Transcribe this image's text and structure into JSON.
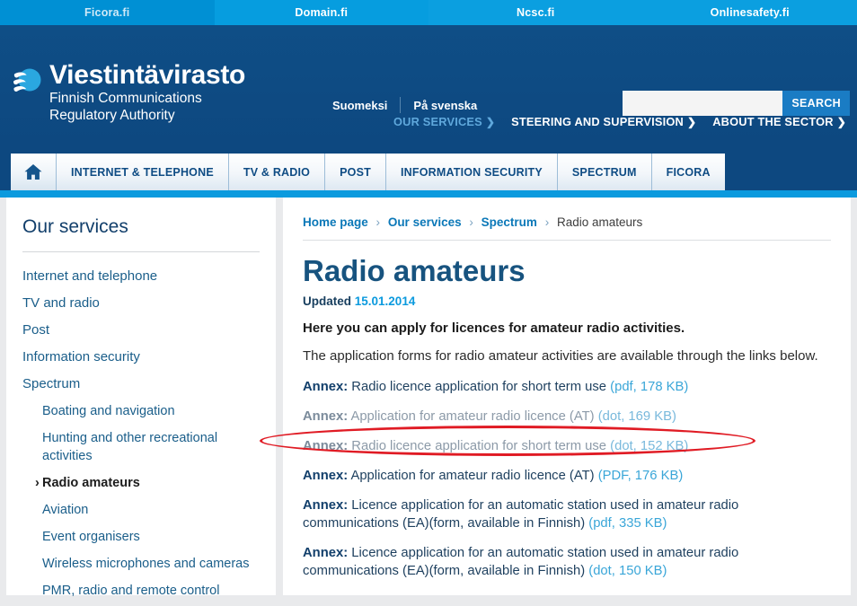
{
  "topbar": {
    "items": [
      {
        "label": "Ficora.fi"
      },
      {
        "label": "Domain.fi"
      },
      {
        "label": "Ncsc.fi"
      },
      {
        "label": "Onlinesafety.fi"
      }
    ]
  },
  "header": {
    "logo_title": "Viestintävirasto",
    "logo_sub_line1": "Finnish Communications",
    "logo_sub_line2": "Regulatory Authority",
    "logo_icon": "globe-icon",
    "lang_fi": "Suomeksi",
    "lang_sv": "På svenska",
    "search_value": "",
    "search_placeholder": "",
    "search_button": "SEARCH",
    "subnav": [
      {
        "label": "OUR SERVICES",
        "active": true
      },
      {
        "label": "STEERING AND SUPERVISION",
        "active": false
      },
      {
        "label": "ABOUT THE SECTOR",
        "active": false
      }
    ]
  },
  "nav": {
    "home_icon": "home-icon",
    "tabs": [
      {
        "label": "INTERNET & TELEPHONE"
      },
      {
        "label": "TV & RADIO"
      },
      {
        "label": "POST"
      },
      {
        "label": "INFORMATION SECURITY"
      },
      {
        "label": "SPECTRUM"
      },
      {
        "label": "FICORA"
      }
    ]
  },
  "sidebar": {
    "title": "Our services",
    "items": [
      {
        "label": "Internet and telephone",
        "level": 1,
        "active": false
      },
      {
        "label": "TV and radio",
        "level": 1,
        "active": false
      },
      {
        "label": "Post",
        "level": 1,
        "active": false
      },
      {
        "label": "Information security",
        "level": 1,
        "active": false
      },
      {
        "label": "Spectrum",
        "level": 1,
        "active": false
      },
      {
        "label": "Boating and navigation",
        "level": 2,
        "active": false
      },
      {
        "label": "Hunting and other recreational activities",
        "level": 2,
        "active": false
      },
      {
        "label": "Radio amateurs",
        "level": 2,
        "active": true,
        "chevron": "›"
      },
      {
        "label": "Aviation",
        "level": 2,
        "active": false
      },
      {
        "label": "Event organisers",
        "level": 2,
        "active": false
      },
      {
        "label": "Wireless microphones and cameras",
        "level": 2,
        "active": false
      },
      {
        "label": "PMR, radio and remote control",
        "level": 2,
        "active": false
      }
    ]
  },
  "content": {
    "breadcrumb": [
      {
        "label": "Home page",
        "link": true
      },
      {
        "label": "Our services",
        "link": true
      },
      {
        "label": "Spectrum",
        "link": true
      },
      {
        "label": "Radio amateurs",
        "link": false
      }
    ],
    "breadcrumb_separator": "›",
    "title": "Radio amateurs",
    "updated_label": "Updated",
    "updated_date": "15.01.2014",
    "lead": "Here you can apply for licences for amateur radio activities.",
    "intro": "The application forms for radio amateur activities are available through the links below.",
    "annex_label": "Annex:",
    "annexes": [
      {
        "text": "Radio licence application for short term use",
        "meta": "(pdf, 178 KB)",
        "dim": false
      },
      {
        "text": "Application for amateur radio licence (AT)",
        "meta": "(dot, 169 KB)",
        "dim": true
      },
      {
        "text": "Radio licence application for short term use",
        "meta": "(dot, 152 KB)",
        "dim": true
      },
      {
        "text": "Application for amateur radio licence (AT)",
        "meta": "(PDF, 176 KB)",
        "dim": false
      },
      {
        "text": "Licence application for an automatic station used in amateur radio communications (EA)(form, available in Finnish)",
        "meta": "(pdf, 335 KB)",
        "dim": false
      },
      {
        "text": "Licence application for an automatic station used in amateur radio communications (EA)(form, available in Finnish)",
        "meta": "(dot, 150 KB)",
        "dim": false
      }
    ]
  },
  "annotation": {
    "shape": "red-ellipse-highlight",
    "color": "#e01b24",
    "target": "annex-row-3"
  }
}
